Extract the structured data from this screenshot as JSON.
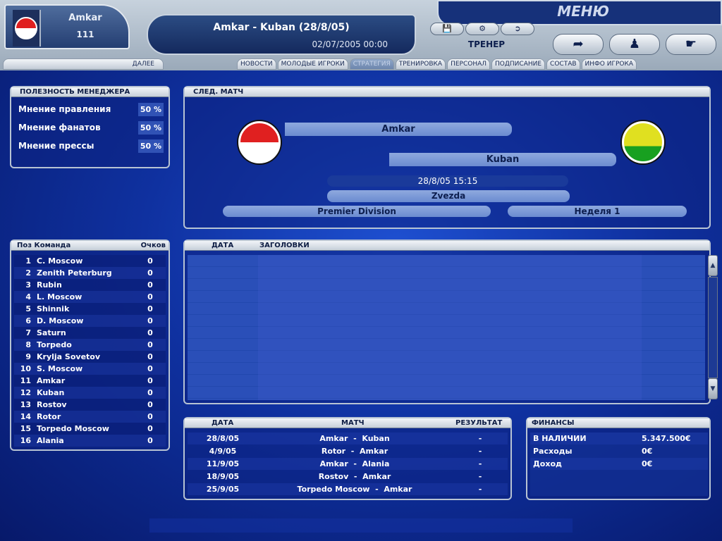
{
  "header": {
    "club_name": "Amkar",
    "club_value": "111",
    "match_title": "Amkar - Kuban (28/8/05)",
    "datetime": "02/07/2005 00:00",
    "menu_title": "МЕНЮ",
    "role": "ТРЕНЕР",
    "next_label": "ДАЛЕЕ",
    "tabs": [
      {
        "label": "НОВОСТИ"
      },
      {
        "label": "МОЛОДЫЕ ИГРОКИ"
      },
      {
        "label": "СТРАТЕГИЯ"
      },
      {
        "label": "ТРЕНИРОВКА"
      },
      {
        "label": "ПЕРСОНАЛ"
      },
      {
        "label": "ПОДПИСАНИЕ"
      },
      {
        "label": "СОСТАВ"
      },
      {
        "label": "ИНФО ИГРОКА"
      }
    ],
    "active_tab": "СТРАТЕГИЯ",
    "icons": [
      "save-icon",
      "settings-icon",
      "exit-icon",
      "redo-arrow-icon",
      "walking-person-icon",
      "pointing-hand-icon"
    ]
  },
  "usefulness": {
    "title": "ПОЛЕЗНОСТЬ МЕНЕДЖЕРА",
    "rows": [
      {
        "label": "Мнение правления",
        "value": "50 %"
      },
      {
        "label": "Мнение фанатов",
        "value": "50 %"
      },
      {
        "label": "Мнение прессы",
        "value": "50 %"
      }
    ]
  },
  "next_match": {
    "title": "СЛЕД. МАТЧ",
    "home": "Amkar",
    "away": "Kuban",
    "datetime": "28/8/05 15:15",
    "stadium": "Zvezda",
    "competition": "Premier Division",
    "week": "Неделя 1",
    "home_colors": [
      "#e02020",
      "#ffffff"
    ],
    "away_colors": [
      "#e0e020",
      "#18a020"
    ]
  },
  "league": {
    "headers": {
      "pos": "Поз",
      "team": "Команда",
      "points": "Очков"
    },
    "rows": [
      {
        "pos": "1",
        "team": "C. Moscow",
        "pts": "0"
      },
      {
        "pos": "2",
        "team": "Zenith Peterburg",
        "pts": "0"
      },
      {
        "pos": "3",
        "team": "Rubin",
        "pts": "0"
      },
      {
        "pos": "4",
        "team": "L. Moscow",
        "pts": "0"
      },
      {
        "pos": "5",
        "team": "Shinnik",
        "pts": "0"
      },
      {
        "pos": "6",
        "team": "D. Moscow",
        "pts": "0"
      },
      {
        "pos": "7",
        "team": "Saturn",
        "pts": "0"
      },
      {
        "pos": "8",
        "team": "Torpedo",
        "pts": "0"
      },
      {
        "pos": "9",
        "team": "Krylja Sovetov",
        "pts": "0"
      },
      {
        "pos": "10",
        "team": "S. Moscow",
        "pts": "0"
      },
      {
        "pos": "11",
        "team": "Amkar",
        "pts": "0"
      },
      {
        "pos": "12",
        "team": "Kuban",
        "pts": "0"
      },
      {
        "pos": "13",
        "team": "Rostov",
        "pts": "0"
      },
      {
        "pos": "14",
        "team": "Rotor",
        "pts": "0"
      },
      {
        "pos": "15",
        "team": "Torpedo Moscow",
        "pts": "0"
      },
      {
        "pos": "16",
        "team": "Alania",
        "pts": "0"
      }
    ]
  },
  "news": {
    "headers": {
      "date": "ДАТА",
      "headline": "ЗАГОЛОВКИ"
    }
  },
  "fixtures": {
    "headers": {
      "date": "ДАТА",
      "match": "МАТЧ",
      "result": "РЕЗУЛЬТАТ"
    },
    "rows": [
      {
        "date": "28/8/05",
        "match": "Amkar  -  Kuban",
        "result": "-"
      },
      {
        "date": "4/9/05",
        "match": "Rotor  -  Amkar",
        "result": "-"
      },
      {
        "date": "11/9/05",
        "match": "Amkar  -  Alania",
        "result": "-"
      },
      {
        "date": "18/9/05",
        "match": "Rostov  -  Amkar",
        "result": "-"
      },
      {
        "date": "25/9/05",
        "match": "Torpedo Moscow  -  Amkar",
        "result": "-"
      }
    ]
  },
  "finances": {
    "title": "ФИНАНСЫ",
    "rows": [
      {
        "label": "В НАЛИЧИИ",
        "value": "5.347.500€"
      },
      {
        "label": "Расходы",
        "value": "0€"
      },
      {
        "label": "Доход",
        "value": "0€"
      }
    ]
  }
}
